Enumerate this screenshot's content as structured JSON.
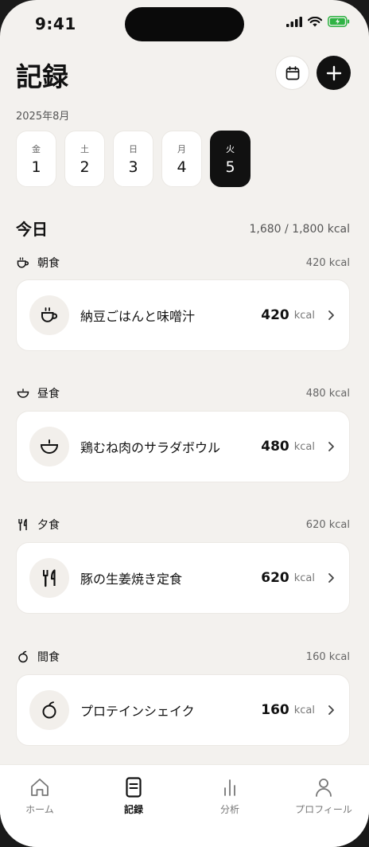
{
  "status_bar": {
    "time": "9:41"
  },
  "header": {
    "title": "記録",
    "month": "2025年8月"
  },
  "days": [
    {
      "weekday": "金",
      "date": "1",
      "selected": false
    },
    {
      "weekday": "土",
      "date": "2",
      "selected": false
    },
    {
      "weekday": "日",
      "date": "3",
      "selected": false
    },
    {
      "weekday": "月",
      "date": "4",
      "selected": false
    },
    {
      "weekday": "火",
      "date": "5",
      "selected": true
    }
  ],
  "today": {
    "label": "今日",
    "total": "1,680 / 1,800 kcal"
  },
  "meals": [
    {
      "type": "朝食",
      "kcal_label": "420 kcal",
      "icon": "coffee-cup-icon",
      "item": "納豆ごはんと味噌汁",
      "kcal": "420",
      "unit": "kcal"
    },
    {
      "type": "昼食",
      "kcal_label": "480 kcal",
      "icon": "bowl-icon",
      "item": "鶏むね肉のサラダボウル",
      "kcal": "480",
      "unit": "kcal"
    },
    {
      "type": "夕食",
      "kcal_label": "620 kcal",
      "icon": "fork-knife-icon",
      "item": "豚の生姜焼き定食",
      "kcal": "620",
      "unit": "kcal"
    },
    {
      "type": "間食",
      "kcal_label": "160 kcal",
      "icon": "apple-icon",
      "item": "プロテインシェイク",
      "kcal": "160",
      "unit": "kcal"
    }
  ],
  "tabs": [
    {
      "label": "ホーム",
      "icon": "home-icon",
      "active": false
    },
    {
      "label": "記録",
      "icon": "document-icon",
      "active": true
    },
    {
      "label": "分析",
      "icon": "bar-chart-icon",
      "active": false
    },
    {
      "label": "プロフィール",
      "icon": "person-icon",
      "active": false
    }
  ],
  "colors": {
    "background": "#f3f1ee",
    "accent": "#111111",
    "card": "#ffffff"
  }
}
